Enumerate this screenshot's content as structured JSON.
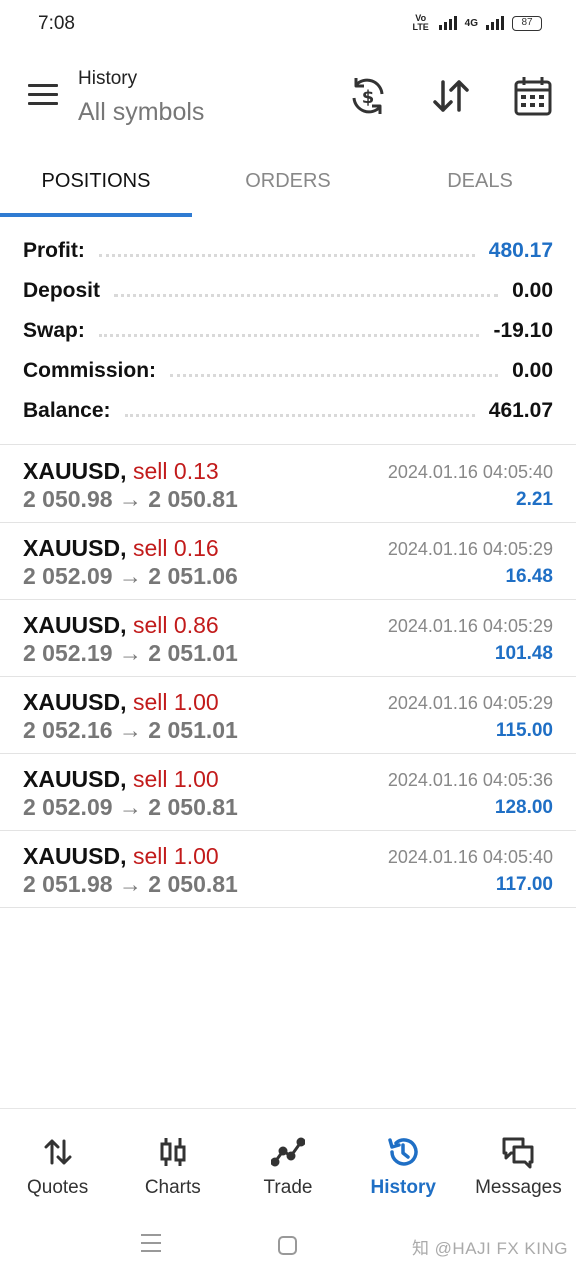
{
  "status_bar": {
    "time": "7:08",
    "network_label": "4G",
    "volte_label": "Vo LTE",
    "battery": "87"
  },
  "header": {
    "title": "History",
    "subtitle": "All symbols",
    "icons": [
      "currency-sync-icon",
      "sort-icon",
      "calendar-icon"
    ]
  },
  "tabs": [
    {
      "label": "POSITIONS",
      "active": true
    },
    {
      "label": "ORDERS",
      "active": false
    },
    {
      "label": "DEALS",
      "active": false
    }
  ],
  "summary": {
    "profit_label": "Profit:",
    "profit_value": "480.17",
    "deposit_label": "Deposit",
    "deposit_value": "0.00",
    "swap_label": "Swap:",
    "swap_value": "-19.10",
    "commission_label": "Commission:",
    "commission_value": "0.00",
    "balance_label": "Balance:",
    "balance_value": "461.07",
    "accent_color": "#1f6fc5"
  },
  "deals": [
    {
      "symbol": "XAUUSD,",
      "side": "sell 0.13",
      "prices": "2 050.98 → 2 050.81",
      "time": "2024.01.16 04:05:40",
      "profit": "2.21"
    },
    {
      "symbol": "XAUUSD,",
      "side": "sell 0.16",
      "prices": "2 052.09 → 2 051.06",
      "time": "2024.01.16 04:05:29",
      "profit": "16.48"
    },
    {
      "symbol": "XAUUSD,",
      "side": "sell 0.86",
      "prices": "2 052.19 → 2 051.01",
      "time": "2024.01.16 04:05:29",
      "profit": "101.48"
    },
    {
      "symbol": "XAUUSD,",
      "side": "sell 1.00",
      "prices": "2 052.16 → 2 051.01",
      "time": "2024.01.16 04:05:29",
      "profit": "115.00"
    },
    {
      "symbol": "XAUUSD,",
      "side": "sell 1.00",
      "prices": "2 052.09 → 2 050.81",
      "time": "2024.01.16 04:05:36",
      "profit": "128.00"
    },
    {
      "symbol": "XAUUSD,",
      "side": "sell 1.00",
      "prices": "2 051.98 → 2 050.81",
      "time": "2024.01.16 04:05:40",
      "profit": "117.00"
    }
  ],
  "bottom_nav": [
    {
      "label": "Quotes",
      "icon": "quotes-icon",
      "active": false
    },
    {
      "label": "Charts",
      "icon": "candlestick-icon",
      "active": false
    },
    {
      "label": "Trade",
      "icon": "trade-line-icon",
      "active": false
    },
    {
      "label": "History",
      "icon": "history-icon",
      "active": true
    },
    {
      "label": "Messages",
      "icon": "messages-icon",
      "active": false
    }
  ],
  "watermark": "知 @HAJI FX KING",
  "colors": {
    "sell": "#c21b1b",
    "profit": "#1f6fc5",
    "tab_indicator": "#2f7bd2"
  }
}
